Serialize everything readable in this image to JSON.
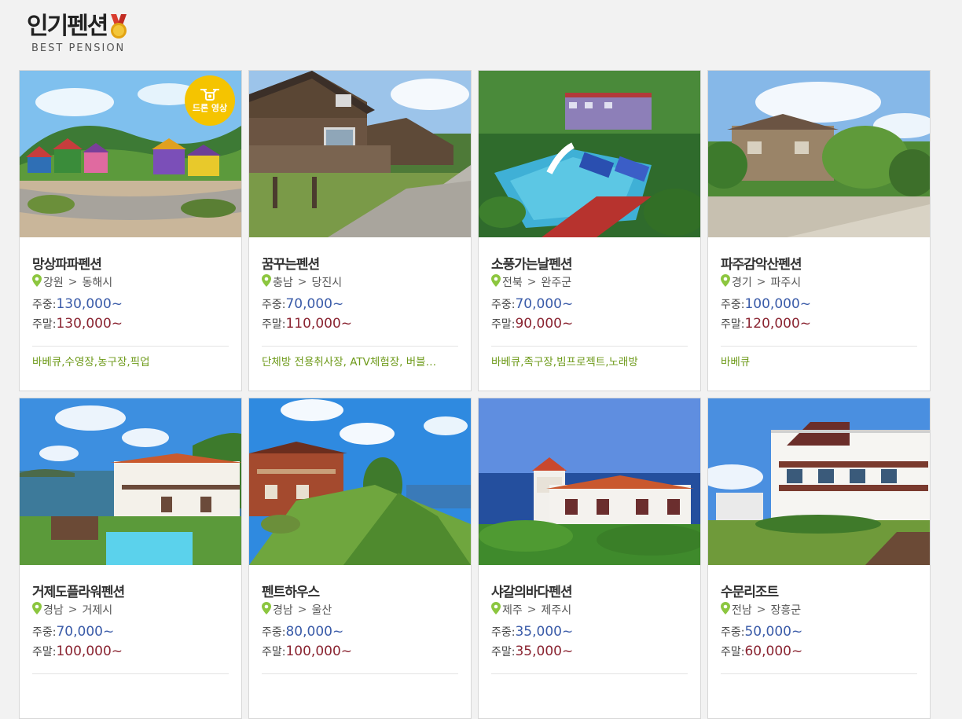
{
  "header": {
    "title": "인기펜션",
    "subtitle": "BEST PENSION"
  },
  "labels": {
    "weekday": "주중:",
    "weekend": "주말:"
  },
  "colors": {
    "weekday_price": "#3a5ba8",
    "weekend_price": "#8a2431",
    "tags": "#6e9a1a",
    "pin": "#8cc63f",
    "badge": "#f5c400"
  },
  "cards": [
    {
      "name": "망상파파펜션",
      "region": "강원",
      "city": "동해시",
      "weekday": "130,000~",
      "weekend": "130,000~",
      "tags": "바베큐,수영장,농구장,픽업",
      "badge": "드론 영상",
      "badge_icon": "drone-icon",
      "photo": "colorful-houses-hillside"
    },
    {
      "name": "꿈꾸는펜션",
      "region": "충남",
      "city": "당진시",
      "weekday": "70,000~",
      "weekend": "110,000~",
      "tags": "단체방 전용취사장, ATV체험장, 버블…",
      "photo": "wooden-cabins-row"
    },
    {
      "name": "소풍가는날펜션",
      "region": "전북",
      "city": "완주군",
      "weekday": "70,000~",
      "weekend": "90,000~",
      "tags": "바베큐,족구장,빔프로젝트,노래방",
      "photo": "pool-water-slide"
    },
    {
      "name": "파주감악산펜션",
      "region": "경기",
      "city": "파주시",
      "weekday": "100,000~",
      "weekend": "120,000~",
      "tags": "바베큐",
      "photo": "house-in-trees"
    },
    {
      "name": "거제도플라워펜션",
      "region": "경남",
      "city": "거제시",
      "weekday": "70,000~",
      "weekend": "100,000~",
      "tags": "",
      "photo": "white-villa-sea-pool"
    },
    {
      "name": "펜트하우스",
      "region": "경남",
      "city": "울산",
      "weekday": "80,000~",
      "weekend": "100,000~",
      "tags": "",
      "photo": "brick-houses-lawn"
    },
    {
      "name": "샤갈의바다펜션",
      "region": "제주",
      "city": "제주시",
      "weekday": "35,000~",
      "weekend": "35,000~",
      "tags": "",
      "photo": "white-house-ocean"
    },
    {
      "name": "수문리조트",
      "region": "전남",
      "city": "장흥군",
      "weekday": "50,000~",
      "weekend": "60,000~",
      "tags": "",
      "photo": "white-resort-building"
    }
  ]
}
